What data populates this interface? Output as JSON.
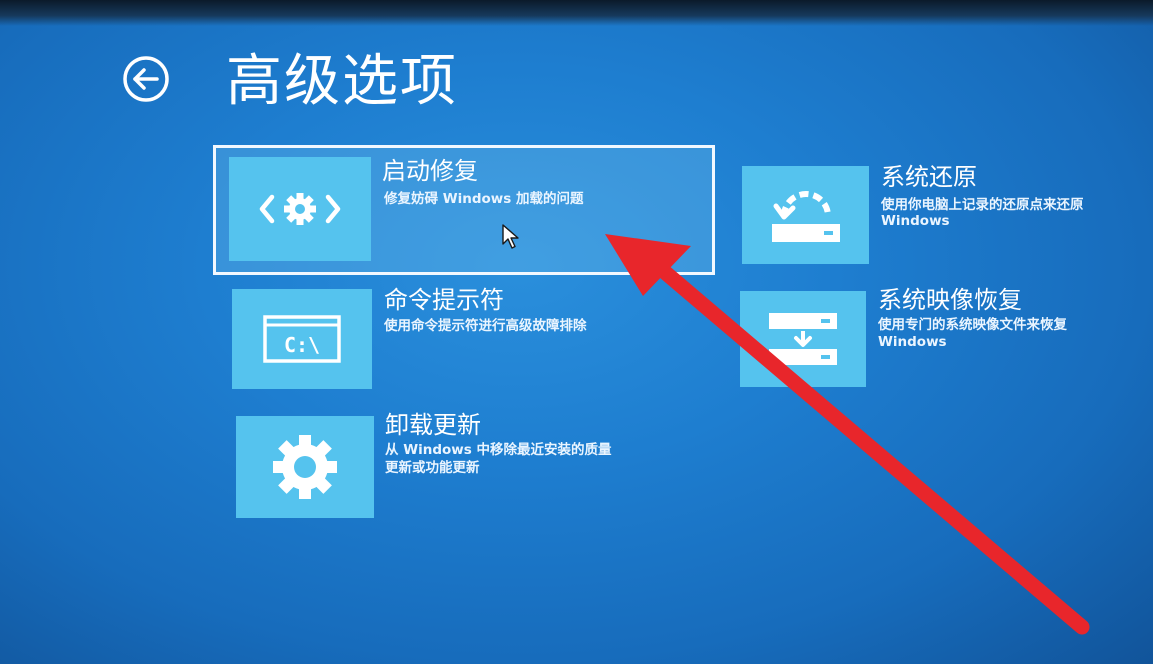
{
  "page": {
    "title": "高级选项",
    "back_icon": "back-arrow-circle-icon"
  },
  "options": {
    "startup_repair": {
      "title": "启动修复",
      "description": "修复妨碍 Windows 加载的问题",
      "icon": "startup-repair-icon",
      "selected": true
    },
    "command_prompt": {
      "title": "命令提示符",
      "description": "使用命令提示符进行高级故障排除",
      "icon": "command-prompt-icon",
      "icon_text": "C:\\"
    },
    "uninstall_updates": {
      "title": "卸载更新",
      "description_line1": "从 Windows 中移除最近安装的质量",
      "description_line2": "更新或功能更新",
      "icon": "gear-icon"
    },
    "system_restore": {
      "title": "系统还原",
      "description_line1": "使用你电脑上记录的还原点来还原",
      "description_line2": "Windows",
      "icon": "system-restore-icon"
    },
    "system_image_recovery": {
      "title": "系统映像恢复",
      "description_line1": "使用专门的系统映像文件来恢复",
      "description_line2": "Windows",
      "icon": "system-image-icon"
    }
  },
  "colors": {
    "background": "#1e7ed0",
    "tile": "#55c3ee",
    "selection_border": "#f2f8ff",
    "annotation_arrow": "#e8262b"
  },
  "overlay": {
    "cursor_icon": "mouse-pointer-icon",
    "annotation": "red-arrow-annotation"
  }
}
